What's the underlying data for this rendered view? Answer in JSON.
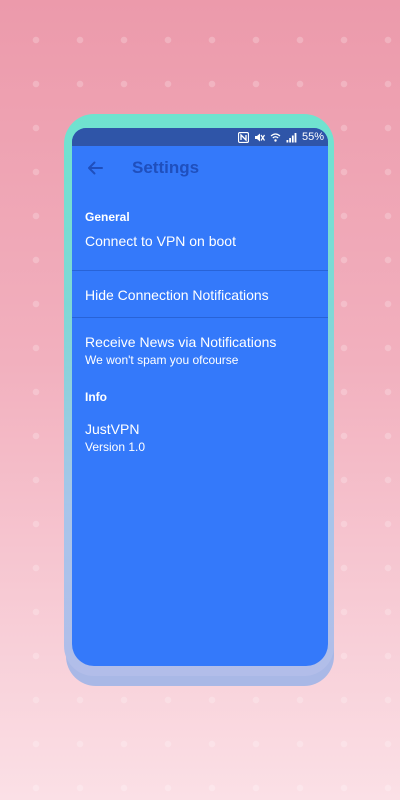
{
  "status_bar": {
    "battery": "55%",
    "icons": [
      "nfc-icon",
      "mute-icon",
      "wifi-icon",
      "signal-icon"
    ]
  },
  "app_bar": {
    "back_icon": "arrow-left-icon",
    "title": "Settings"
  },
  "sections": {
    "general": {
      "header": "General",
      "items": [
        {
          "title": "Connect to VPN on boot"
        },
        {
          "title": "Hide Connection Notifications"
        },
        {
          "title": "Receive News via Notifications",
          "summary": "We won't spam you ofcourse"
        }
      ]
    },
    "info": {
      "header": "Info",
      "items": [
        {
          "title": "JustVPN",
          "summary": "Version 1.0"
        }
      ]
    }
  },
  "colors": {
    "screen_bg": "#3479fa",
    "status_bar": "#2f55a8",
    "title_text": "#1f4fbd",
    "phone_frame": "#6fe3cf",
    "background": "#ec9aab"
  }
}
